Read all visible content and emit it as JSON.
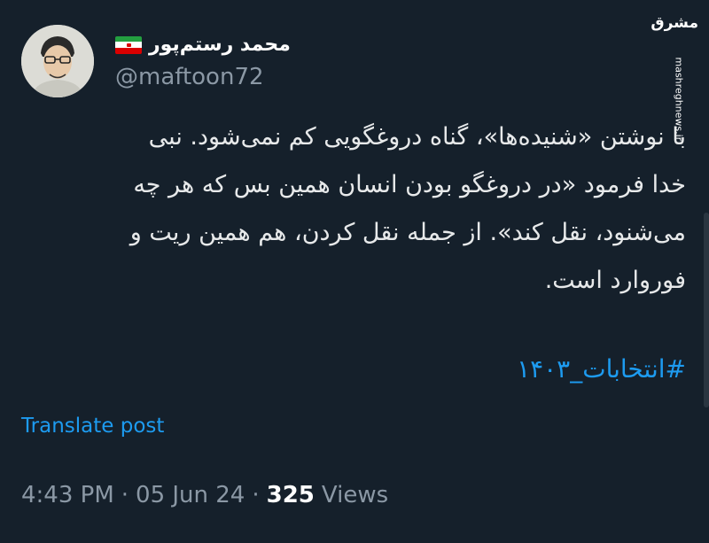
{
  "tweet": {
    "display_name": "محمد رستم‌پور",
    "handle": "@maftoon72",
    "flag": "iran-flag-icon",
    "text": "با نوشتن «شنیده‌ها»، گناه دروغگویی کم نمی‌شود. نبی\nخدا فرمود «در دروغگو بودن انسان همین بس که هر چه\nمی‌شنود، نقل کند». از جمله نقل کردن، هم همین ریت و\nفوروارد است.",
    "hashtag": "#انتخابات_۱۴۰۳",
    "translate_label": "Translate post",
    "time": "4:43 PM",
    "sep1": "·",
    "date": "05 Jun 24",
    "sep2": "·",
    "views_count": "325",
    "views_label": "Views"
  },
  "watermark": {
    "logo": "مشرق",
    "url": "mashreghnews.ir"
  },
  "colors": {
    "background": "#15202b",
    "link": "#1d9bf0",
    "muted": "#8b98a5"
  }
}
